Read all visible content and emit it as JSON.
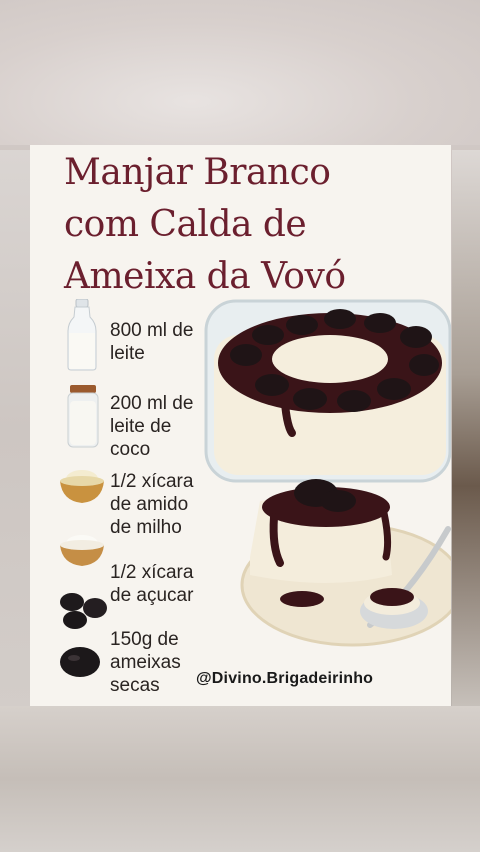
{
  "title": {
    "line1": "Manjar Branco",
    "line2": "com Calda de",
    "line3": "Ameixa da Vovó"
  },
  "ingredients": [
    {
      "text": "800 ml de\nleite",
      "icon": "milk-bottle-icon"
    },
    {
      "text": "200 ml de\nleite de\ncoco",
      "icon": "coconut-milk-jar-icon"
    },
    {
      "text": "1/2 xícara\nde amido\nde milho",
      "icon": "cornstarch-bowl-icon"
    },
    {
      "text": "1/2 xícara\nde açucar",
      "icon": "sugar-bowl-icon"
    },
    {
      "text": "150g de\nameixas\nsecas",
      "icon": "prunes-icon"
    }
  ],
  "handle": "@Divino.Brigadeirinho",
  "colors": {
    "title": "#6b1f2e",
    "card_bg": "#f7f4ef",
    "sauce": "#3a1418",
    "cream": "#f3ecdc"
  }
}
